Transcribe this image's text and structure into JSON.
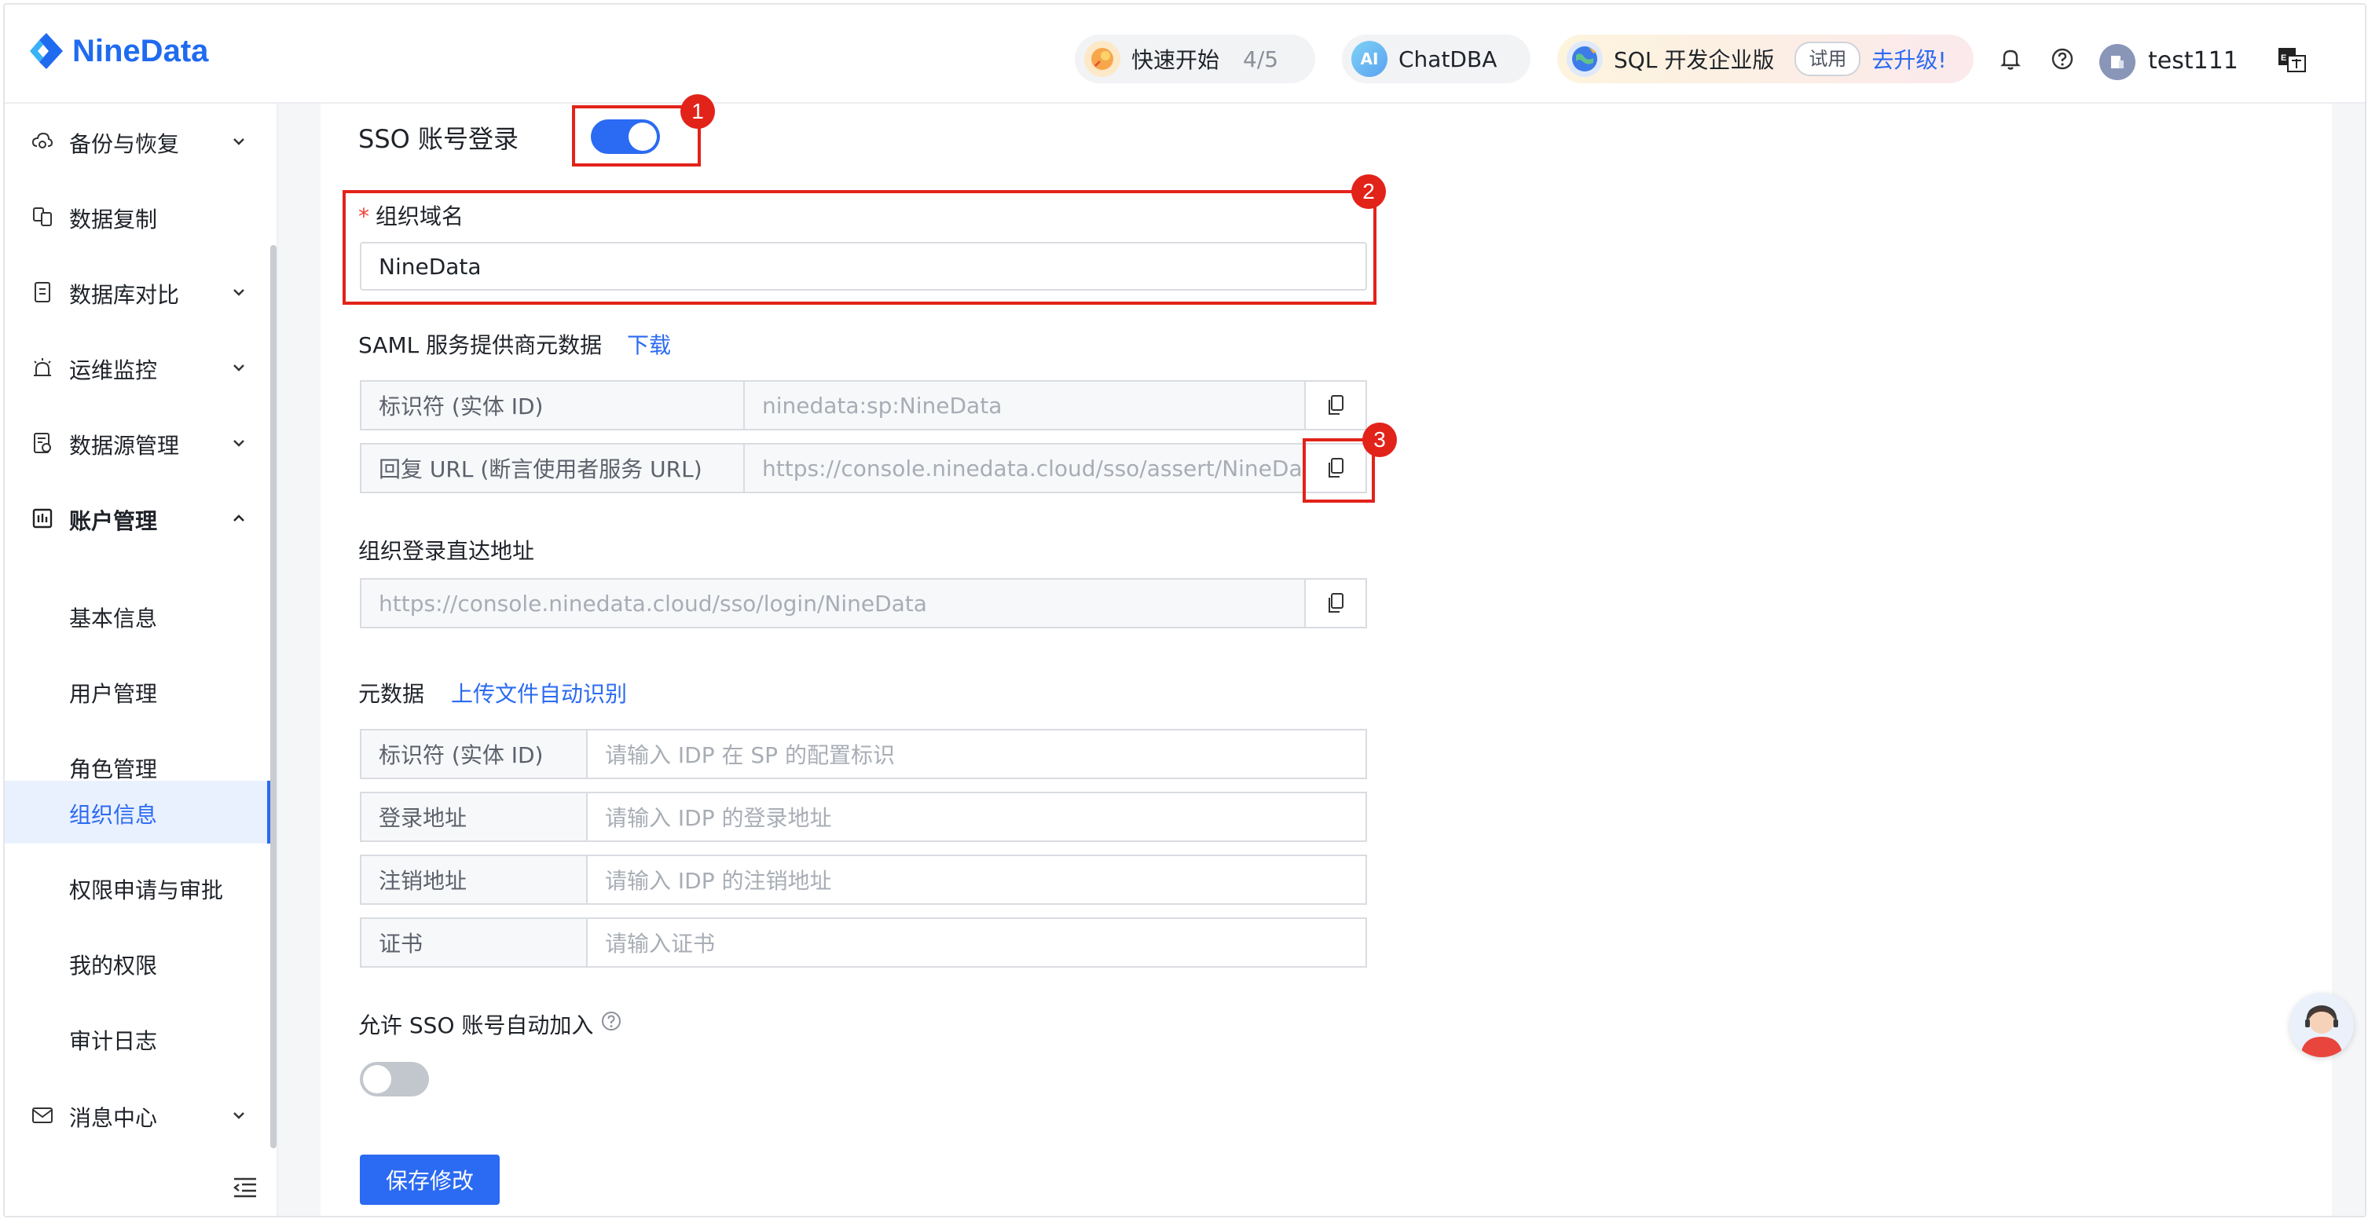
{
  "header": {
    "brand": "NineData",
    "quick_start": {
      "label": "快速开始",
      "progress": "4/5"
    },
    "chatdba": {
      "label": "ChatDBA",
      "icon_text": "AI"
    },
    "edition": {
      "label": "SQL 开发企业版",
      "tag": "试用",
      "upgrade": "去升级!"
    },
    "username": "test111"
  },
  "sidebar": {
    "items": [
      {
        "label": "备份与恢复",
        "icon": "cloud-backup-icon",
        "expandable": true
      },
      {
        "label": "数据复制",
        "icon": "copy-data-icon",
        "expandable": false
      },
      {
        "label": "数据库对比",
        "icon": "compare-icon",
        "expandable": true
      },
      {
        "label": "运维监控",
        "icon": "alarm-icon",
        "expandable": true
      },
      {
        "label": "数据源管理",
        "icon": "datasource-icon",
        "expandable": true
      },
      {
        "label": "账户管理",
        "icon": "account-icon",
        "expandable": true,
        "expanded": true
      }
    ],
    "sub_items": [
      {
        "label": "基本信息"
      },
      {
        "label": "用户管理"
      },
      {
        "label": "角色管理"
      },
      {
        "label": "组织信息",
        "active": true
      },
      {
        "label": "权限申请与审批"
      },
      {
        "label": "我的权限"
      },
      {
        "label": "审计日志"
      }
    ],
    "message_center": {
      "label": "消息中心",
      "icon": "mail-icon"
    }
  },
  "form": {
    "sso_label": "SSO 账号登录",
    "sso_enabled": true,
    "domain_label": "组织域名",
    "domain_value": "NineData",
    "saml_label": "SAML 服务提供商元数据",
    "saml_download": "下载",
    "saml_rows": [
      {
        "key": "标识符 (实体 ID)",
        "value": "ninedata:sp:NineData"
      },
      {
        "key": "回复 URL (断言使用者服务 URL)",
        "value": "https://console.ninedata.cloud/sso/assert/NineData"
      }
    ],
    "direct_label": "组织登录直达地址",
    "direct_value": "https://console.ninedata.cloud/sso/login/NineData",
    "metadata_label": "元数据",
    "metadata_upload": "上传文件自动识别",
    "metadata_rows": [
      {
        "key": "标识符 (实体 ID)",
        "placeholder": "请输入 IDP 在 SP 的配置标识"
      },
      {
        "key": "登录地址",
        "placeholder": "请输入 IDP 的登录地址"
      },
      {
        "key": "注销地址",
        "placeholder": "请输入 IDP 的注销地址"
      },
      {
        "key": "证书",
        "placeholder": "请输入证书"
      }
    ],
    "auto_join_label": "允许 SSO 账号自动加入",
    "auto_join_enabled": false,
    "save_button": "保存修改"
  },
  "annotations": [
    "1",
    "2",
    "3"
  ],
  "colors": {
    "accent": "#2b6af2",
    "annotation": "#e2231a",
    "brand": "#1f6bf0"
  }
}
